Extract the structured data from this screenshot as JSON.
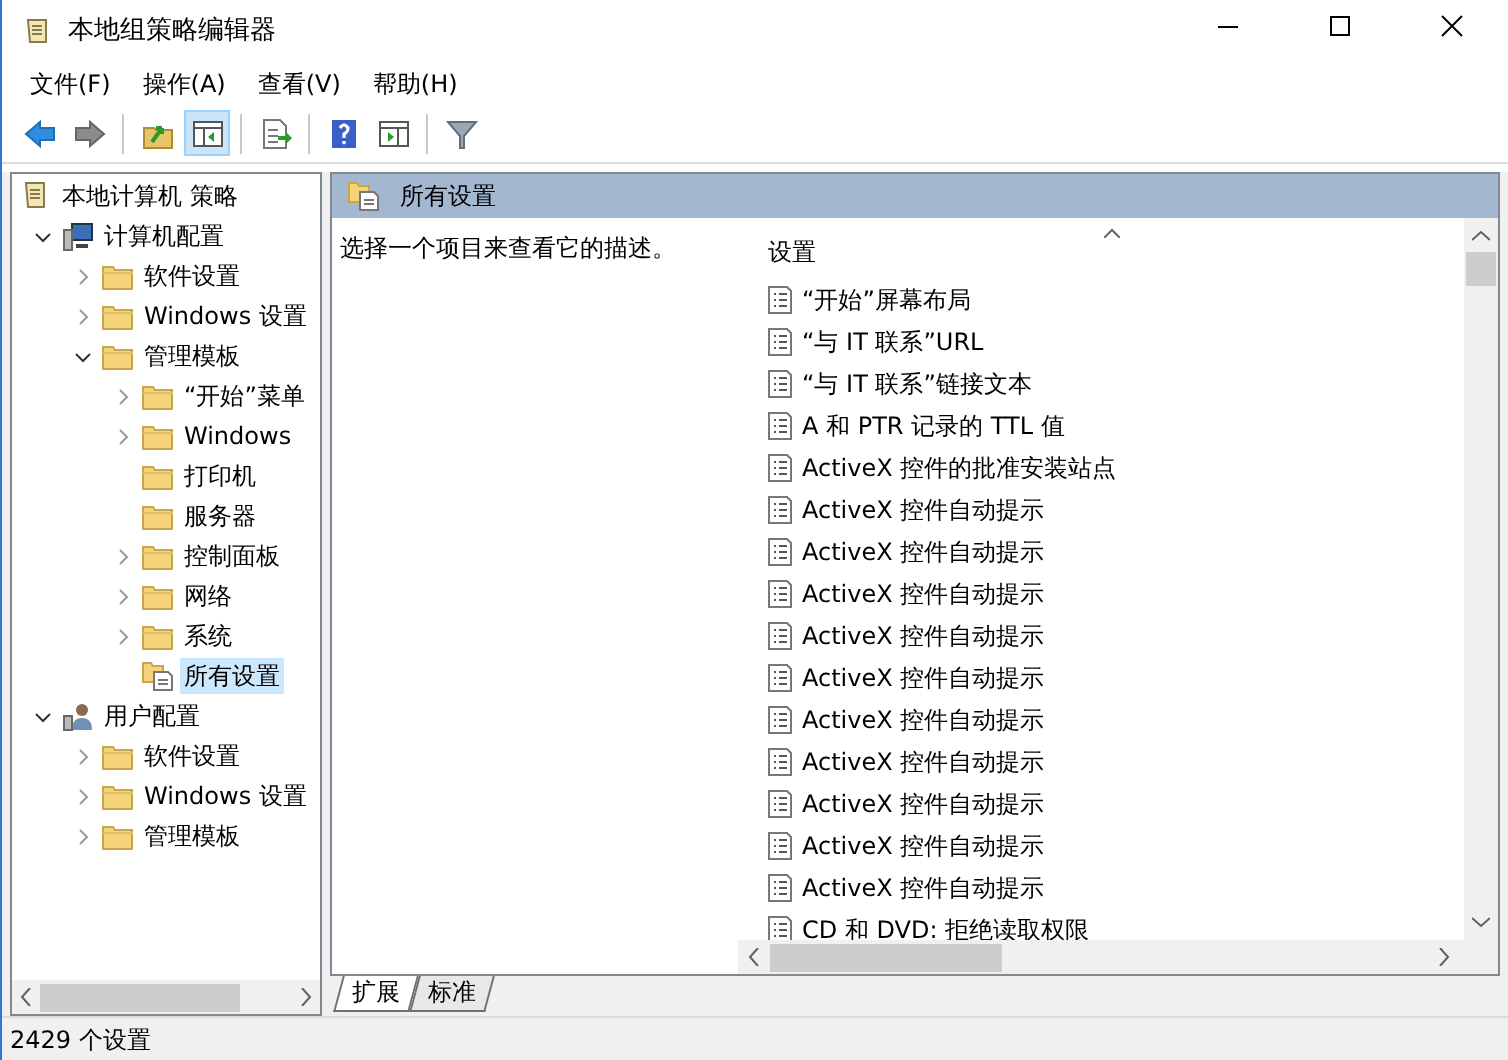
{
  "window": {
    "title": "本地组策略编辑器"
  },
  "menu": [
    "文件(F)",
    "操作(A)",
    "查看(V)",
    "帮助(H)"
  ],
  "toolbar": [
    {
      "kind": "back",
      "pressed": false
    },
    {
      "kind": "forward",
      "pressed": false
    },
    {
      "kind": "separator"
    },
    {
      "kind": "up",
      "pressed": false
    },
    {
      "kind": "tree",
      "pressed": true
    },
    {
      "kind": "separator"
    },
    {
      "kind": "export",
      "pressed": false
    },
    {
      "kind": "separator"
    },
    {
      "kind": "help",
      "pressed": false
    },
    {
      "kind": "pane",
      "pressed": false
    },
    {
      "kind": "separator"
    },
    {
      "kind": "filter",
      "pressed": false
    }
  ],
  "tree": [
    {
      "label": "本地计算机 策略",
      "kind": "policy",
      "selected": false,
      "children": [
        {
          "label": "计算机配置",
          "kind": "computer",
          "expanded": true,
          "selected": false,
          "children": [
            {
              "label": "软件设置",
              "kind": "folder",
              "expanded": false,
              "selected": false
            },
            {
              "label": "Windows 设置",
              "kind": "folder",
              "expanded": false,
              "selected": false
            },
            {
              "label": "管理模板",
              "kind": "folder",
              "expanded": true,
              "selected": false,
              "children": [
                {
                  "label": "“开始”菜单",
                  "kind": "folder",
                  "expanded": false,
                  "selected": false
                },
                {
                  "label": "Windows",
                  "kind": "folder",
                  "expanded": false,
                  "selected": false
                },
                {
                  "label": "打印机",
                  "kind": "folder",
                  "selected": false
                },
                {
                  "label": "服务器",
                  "kind": "folder",
                  "selected": false
                },
                {
                  "label": "控制面板",
                  "kind": "folder",
                  "expanded": false,
                  "selected": false
                },
                {
                  "label": "网络",
                  "kind": "folder",
                  "expanded": false,
                  "selected": false
                },
                {
                  "label": "系统",
                  "kind": "folder",
                  "expanded": false,
                  "selected": false
                },
                {
                  "label": "所有设置",
                  "kind": "all-settings",
                  "selected": true
                }
              ]
            }
          ]
        },
        {
          "label": "用户配置",
          "kind": "user",
          "expanded": true,
          "selected": false,
          "children": [
            {
              "label": "软件设置",
              "kind": "folder",
              "expanded": false,
              "selected": false
            },
            {
              "label": "Windows 设置",
              "kind": "folder",
              "expanded": false,
              "selected": false
            },
            {
              "label": "管理模板",
              "kind": "folder",
              "expanded": false,
              "selected": false
            }
          ]
        }
      ]
    }
  ],
  "pane_header": "所有设置",
  "description": "选择一个项目来查看它的描述。",
  "list": {
    "column": "设置",
    "rows": [
      "“开始”屏幕布局",
      "“与 IT 联系”URL",
      "“与 IT 联系”链接文本",
      "A 和 PTR 记录的 TTL 值",
      "ActiveX 控件的批准安装站点",
      "ActiveX 控件自动提示",
      "ActiveX 控件自动提示",
      "ActiveX 控件自动提示",
      "ActiveX 控件自动提示",
      "ActiveX 控件自动提示",
      "ActiveX 控件自动提示",
      "ActiveX 控件自动提示",
      "ActiveX 控件自动提示",
      "ActiveX 控件自动提示",
      "ActiveX 控件自动提示",
      "CD 和 DVD: 拒绝读取权限"
    ]
  },
  "tabs": [
    {
      "label": "扩展",
      "selected": true
    },
    {
      "label": "标准",
      "selected": false
    }
  ],
  "status_bar": "2429 个设置"
}
